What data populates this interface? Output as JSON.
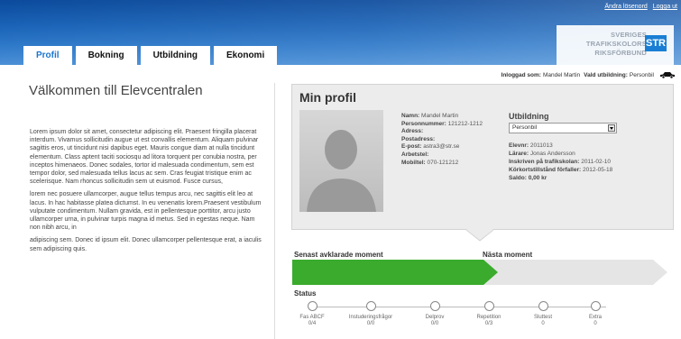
{
  "top_links": [
    "Ändra lösenord",
    "Logga ut"
  ],
  "logo": {
    "line1": "SVERIGES",
    "line2": "TRAFIKSKOLORS",
    "line3": "RIKSFÖRBUND",
    "mark": "STR"
  },
  "tabs": [
    {
      "label": "Profil",
      "active": true
    },
    {
      "label": "Bokning",
      "active": false
    },
    {
      "label": "Utbildning",
      "active": false
    },
    {
      "label": "Ekonomi",
      "active": false
    }
  ],
  "login": {
    "label": "Inloggad som:",
    "user": "Mandel Martin",
    "edu_label": "Vald utbildning:",
    "edu": "Personbil"
  },
  "welcome": "Välkommen till Elevcentralen",
  "paragraphs": [
    "Lorem ipsum dolor sit amet, consectetur adipiscing elit. Praesent fringilla placerat interdum. Vivamus sollicitudin augue ut est convallis elementum. Aliquam pulvinar sagittis eros, ut tincidunt nisi dapibus eget. Mauris congue diam at nulla tincidunt elementum. Class aptent taciti sociosqu ad litora torquent per conubia nostra, per inceptos himenaeos. Donec sodales, tortor id malesuada condimentum, sem est tempor dolor, sed malesuada tellus lacus ac sem. Cras feugiat tristique enim ac scelerisque. Nam rhoncus sollicitudin sem ut euismod. Fusce cursus,",
    "lorem nec posuere ullamcorper, augue tellus tempus arcu, nec sagittis elit leo at lacus. In hac habitasse platea dictumst. In eu venenatis lorem.Praesent vestibulum vulputate condimentum. Nullam gravida, est in pellentesque porttitor, arcu justo ullamcorper urna, in pulvinar turpis magna id metus. Sed in egestas neque. Nam non nibh arcu, in",
    "adipiscing sem. Donec id ipsum elit. Donec ullamcorper pellentesque erat, a iaculis sem adipiscing quis."
  ],
  "profile": {
    "title": "Min profil",
    "name_label": "Namn:",
    "name": "Mandel Martin",
    "pnr_label": "Personnummer:",
    "pnr": "121212-1212",
    "address_label": "Adress:",
    "address": "",
    "postal_label": "Postadress:",
    "postal": "",
    "email_label": "E-post:",
    "email": "astra3@str.se",
    "work_label": "Arbetstel:",
    "work": "",
    "mobile_label": "Mobiltel:",
    "mobile": "070-121212"
  },
  "education": {
    "title": "Utbildning",
    "selected": "Personbil",
    "student_no_label": "Elevnr:",
    "student_no": "2011013",
    "teacher_label": "Lärare:",
    "teacher": "Jonas Andersson",
    "enrolled_label": "Inskriven på trafikskolan:",
    "enrolled": "2011-02-10",
    "expires_label": "Körkortstillstånd förfaller:",
    "expires": "2012-05-18",
    "balance_label": "Saldo:",
    "balance": "0,00 kr"
  },
  "moments": {
    "done_label": "Senast avklarade moment",
    "next_label": "Nästa moment",
    "done_color": "#3aab2c",
    "next_color": "#e5e5e5"
  },
  "status": {
    "title": "Status",
    "steps": [
      {
        "name": "Fas ABCF",
        "value": "0/4"
      },
      {
        "name": "Instuderingsfrågor",
        "value": "0/0"
      },
      {
        "name": "Delprov",
        "value": "0/0"
      },
      {
        "name": "Repetition",
        "value": "0/3"
      },
      {
        "name": "Sluttest",
        "value": "0"
      },
      {
        "name": "Extra",
        "value": "0"
      }
    ]
  }
}
